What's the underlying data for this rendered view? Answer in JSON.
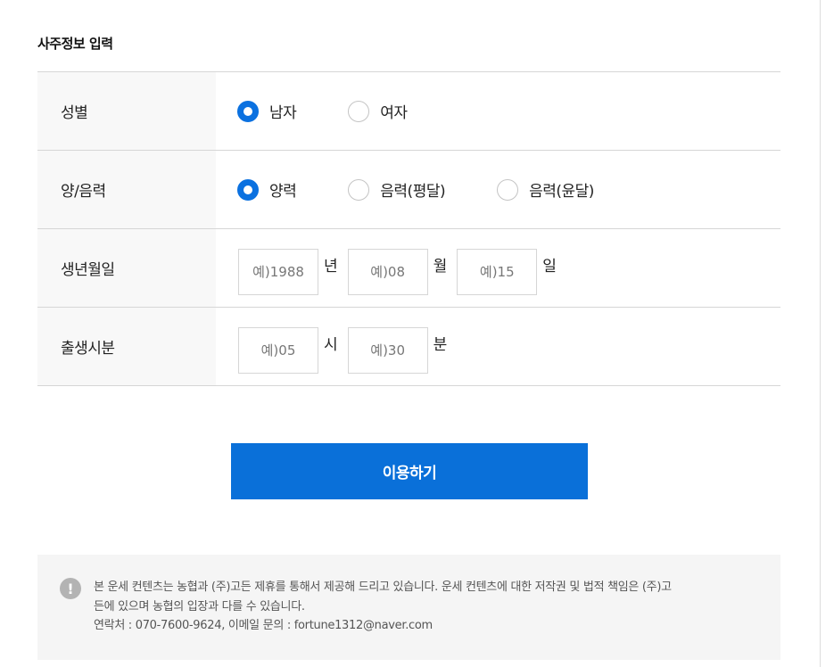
{
  "section": {
    "title": "사주정보 입력"
  },
  "gender": {
    "label": "성별",
    "options": [
      "남자",
      "여자"
    ],
    "selected": "남자"
  },
  "calendar": {
    "label": "양/음력",
    "options": [
      "양력",
      "음력(평달)",
      "음력(윤달)"
    ],
    "selected": "양력"
  },
  "birthdate": {
    "label": "생년월일",
    "year_placeholder": "예)1988",
    "year_unit": "년",
    "month_placeholder": "예)08",
    "month_unit": "월",
    "day_placeholder": "예)15",
    "day_unit": "일"
  },
  "birthtime": {
    "label": "출생시분",
    "hour_placeholder": "예)05",
    "hour_unit": "시",
    "minute_placeholder": "예)30",
    "minute_unit": "분"
  },
  "submit": {
    "label": "이용하기"
  },
  "notice": {
    "icon": "exclamation-icon",
    "icon_glyph": "!",
    "line1": "본 운세 컨텐츠는 농협과 (주)고든 제휴를 통해서 제공해 드리고 있습니다. 운세 컨텐츠에 대한 저작권 및 법적 책임은 (주)고",
    "line2": "든에 있으며 농협의 입장과 다를 수 있습니다.",
    "line3": "연락처 : 070-7600-9624, 이메일 문의 : fortune1312@naver.com"
  },
  "colors": {
    "accent": "#0a70d9",
    "label_bg": "#f8f8f8",
    "notice_bg": "#f5f5f5",
    "border": "#d6d6d6"
  }
}
